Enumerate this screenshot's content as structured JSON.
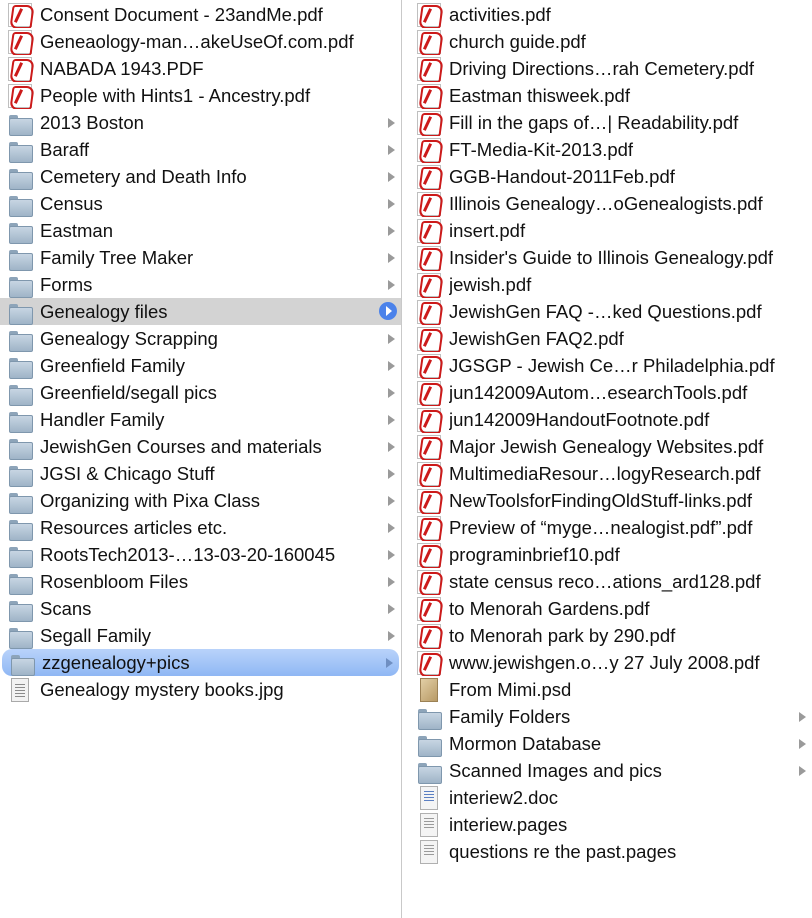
{
  "window": {
    "view": "column"
  },
  "columns": [
    {
      "name": "parent-folder",
      "items": [
        {
          "label": "Consent Document - 23andMe.pdf",
          "kind": "pdf",
          "icon": "pdf-icon"
        },
        {
          "label": "Geneaology-man…akeUseOf.com.pdf",
          "kind": "pdf",
          "icon": "pdf-icon"
        },
        {
          "label": "NABADA 1943.PDF",
          "kind": "pdf",
          "icon": "pdf-icon"
        },
        {
          "label": "People with Hints1 - Ancestry.pdf",
          "kind": "pdf",
          "icon": "pdf-icon"
        },
        {
          "label": "2013 Boston",
          "kind": "folder",
          "icon": "folder-icon"
        },
        {
          "label": "Baraff",
          "kind": "folder",
          "icon": "folder-icon"
        },
        {
          "label": "Cemetery and Death Info",
          "kind": "folder",
          "icon": "folder-icon"
        },
        {
          "label": "Census",
          "kind": "folder",
          "icon": "folder-icon"
        },
        {
          "label": "Eastman",
          "kind": "folder",
          "icon": "folder-icon"
        },
        {
          "label": "Family Tree Maker",
          "kind": "folder",
          "icon": "folder-icon"
        },
        {
          "label": "Forms",
          "kind": "folder",
          "icon": "folder-icon"
        },
        {
          "label": "Genealogy files",
          "kind": "folder",
          "icon": "folder-icon",
          "selected": "inactive"
        },
        {
          "label": "Genealogy Scrapping",
          "kind": "folder",
          "icon": "folder-icon"
        },
        {
          "label": "Greenfield Family",
          "kind": "folder",
          "icon": "folder-icon"
        },
        {
          "label": "Greenfield/segall pics",
          "kind": "folder",
          "icon": "folder-icon"
        },
        {
          "label": "Handler Family",
          "kind": "folder",
          "icon": "folder-icon"
        },
        {
          "label": "JewishGen Courses and materials",
          "kind": "folder",
          "icon": "folder-icon"
        },
        {
          "label": "JGSI & Chicago Stuff",
          "kind": "folder",
          "icon": "folder-icon"
        },
        {
          "label": "Organizing with Pixa Class",
          "kind": "folder",
          "icon": "folder-icon"
        },
        {
          "label": "Resources articles etc.",
          "kind": "folder",
          "icon": "folder-icon"
        },
        {
          "label": "RootsTech2013-…13-03-20-160045",
          "kind": "folder",
          "icon": "folder-icon"
        },
        {
          "label": "Rosenbloom Files",
          "kind": "folder",
          "icon": "folder-icon"
        },
        {
          "label": "Scans",
          "kind": "folder",
          "icon": "folder-icon"
        },
        {
          "label": "Segall Family",
          "kind": "folder",
          "icon": "folder-icon"
        },
        {
          "label": "zzgenealogy+pics",
          "kind": "folder",
          "icon": "folder-icon",
          "selected": "active"
        },
        {
          "label": "Genealogy mystery books.jpg",
          "kind": "jpg",
          "icon": "image-file-icon"
        }
      ]
    },
    {
      "name": "child-folder",
      "items": [
        {
          "label": "activities.pdf",
          "kind": "pdf",
          "icon": "pdf-icon"
        },
        {
          "label": "church guide.pdf",
          "kind": "pdf",
          "icon": "pdf-icon"
        },
        {
          "label": "Driving Directions…rah Cemetery.pdf",
          "kind": "pdf",
          "icon": "pdf-icon"
        },
        {
          "label": "Eastman thisweek.pdf",
          "kind": "pdf",
          "icon": "pdf-icon"
        },
        {
          "label": "Fill in the gaps of…| Readability.pdf",
          "kind": "pdf",
          "icon": "pdf-icon"
        },
        {
          "label": "FT-Media-Kit-2013.pdf",
          "kind": "pdf",
          "icon": "pdf-icon"
        },
        {
          "label": "GGB-Handout-2011Feb.pdf",
          "kind": "pdf",
          "icon": "pdf-icon"
        },
        {
          "label": "Illinois Genealogy…oGenealogists.pdf",
          "kind": "pdf",
          "icon": "pdf-icon"
        },
        {
          "label": "insert.pdf",
          "kind": "pdf",
          "icon": "pdf-icon"
        },
        {
          "label": "Insider's Guide to Illinois Genealogy.pdf",
          "kind": "pdf",
          "icon": "pdf-icon"
        },
        {
          "label": "jewish.pdf",
          "kind": "pdf",
          "icon": "pdf-icon"
        },
        {
          "label": "JewishGen FAQ -…ked Questions.pdf",
          "kind": "pdf",
          "icon": "pdf-icon"
        },
        {
          "label": "JewishGen FAQ2.pdf",
          "kind": "pdf",
          "icon": "pdf-icon"
        },
        {
          "label": "JGSGP - Jewish Ce…r Philadelphia.pdf",
          "kind": "pdf",
          "icon": "pdf-icon"
        },
        {
          "label": "jun142009Autom…esearchTools.pdf",
          "kind": "pdf",
          "icon": "pdf-icon"
        },
        {
          "label": "jun142009HandoutFootnote.pdf",
          "kind": "pdf",
          "icon": "pdf-icon"
        },
        {
          "label": "Major Jewish Genealogy Websites.pdf",
          "kind": "pdf",
          "icon": "pdf-icon"
        },
        {
          "label": "MultimediaResour…logyResearch.pdf",
          "kind": "pdf",
          "icon": "pdf-icon"
        },
        {
          "label": "NewToolsforFindingOldStuff-links.pdf",
          "kind": "pdf",
          "icon": "pdf-icon"
        },
        {
          "label": "Preview of “myge…nealogist.pdf”.pdf",
          "kind": "pdf",
          "icon": "pdf-icon"
        },
        {
          "label": "programinbrief10.pdf",
          "kind": "pdf",
          "icon": "pdf-icon"
        },
        {
          "label": "state census reco…ations_ard128.pdf",
          "kind": "pdf",
          "icon": "pdf-icon"
        },
        {
          "label": "to Menorah Gardens.pdf",
          "kind": "pdf",
          "icon": "pdf-icon"
        },
        {
          "label": "to Menorah park by 290.pdf",
          "kind": "pdf",
          "icon": "pdf-icon"
        },
        {
          "label": "www.jewishgen.o…y 27 July 2008.pdf",
          "kind": "pdf",
          "icon": "pdf-icon"
        },
        {
          "label": "From Mimi.psd",
          "kind": "psd",
          "icon": "photoshop-file-icon"
        },
        {
          "label": "Family Folders",
          "kind": "folder",
          "icon": "folder-icon"
        },
        {
          "label": "Mormon Database",
          "kind": "folder",
          "icon": "folder-icon"
        },
        {
          "label": "Scanned Images and pics",
          "kind": "folder",
          "icon": "folder-icon"
        },
        {
          "label": "interiew2.doc",
          "kind": "doc",
          "icon": "word-document-icon"
        },
        {
          "label": "interiew.pages",
          "kind": "pages",
          "icon": "pages-document-icon"
        },
        {
          "label": "questions re the past.pages",
          "kind": "pages",
          "icon": "pages-document-icon"
        }
      ]
    }
  ]
}
